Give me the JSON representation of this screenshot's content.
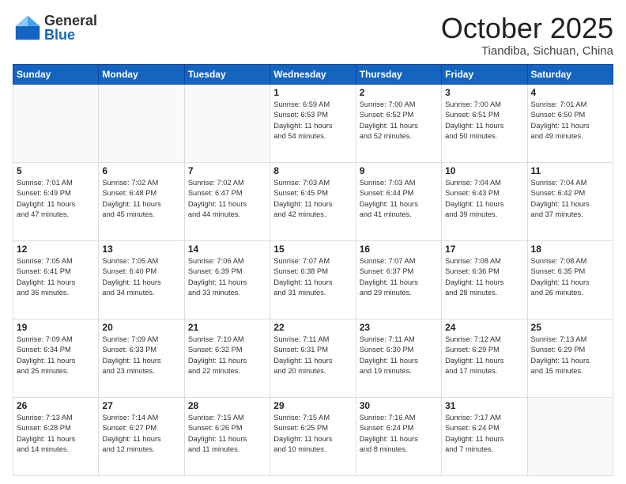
{
  "header": {
    "logo_general": "General",
    "logo_blue": "Blue",
    "month": "October 2025",
    "location": "Tiandiba, Sichuan, China"
  },
  "weekdays": [
    "Sunday",
    "Monday",
    "Tuesday",
    "Wednesday",
    "Thursday",
    "Friday",
    "Saturday"
  ],
  "weeks": [
    [
      {
        "day": "",
        "info": ""
      },
      {
        "day": "",
        "info": ""
      },
      {
        "day": "",
        "info": ""
      },
      {
        "day": "1",
        "info": "Sunrise: 6:59 AM\nSunset: 6:53 PM\nDaylight: 11 hours\nand 54 minutes."
      },
      {
        "day": "2",
        "info": "Sunrise: 7:00 AM\nSunset: 6:52 PM\nDaylight: 11 hours\nand 52 minutes."
      },
      {
        "day": "3",
        "info": "Sunrise: 7:00 AM\nSunset: 6:51 PM\nDaylight: 11 hours\nand 50 minutes."
      },
      {
        "day": "4",
        "info": "Sunrise: 7:01 AM\nSunset: 6:50 PM\nDaylight: 11 hours\nand 49 minutes."
      }
    ],
    [
      {
        "day": "5",
        "info": "Sunrise: 7:01 AM\nSunset: 6:49 PM\nDaylight: 11 hours\nand 47 minutes."
      },
      {
        "day": "6",
        "info": "Sunrise: 7:02 AM\nSunset: 6:48 PM\nDaylight: 11 hours\nand 45 minutes."
      },
      {
        "day": "7",
        "info": "Sunrise: 7:02 AM\nSunset: 6:47 PM\nDaylight: 11 hours\nand 44 minutes."
      },
      {
        "day": "8",
        "info": "Sunrise: 7:03 AM\nSunset: 6:45 PM\nDaylight: 11 hours\nand 42 minutes."
      },
      {
        "day": "9",
        "info": "Sunrise: 7:03 AM\nSunset: 6:44 PM\nDaylight: 11 hours\nand 41 minutes."
      },
      {
        "day": "10",
        "info": "Sunrise: 7:04 AM\nSunset: 6:43 PM\nDaylight: 11 hours\nand 39 minutes."
      },
      {
        "day": "11",
        "info": "Sunrise: 7:04 AM\nSunset: 6:42 PM\nDaylight: 11 hours\nand 37 minutes."
      }
    ],
    [
      {
        "day": "12",
        "info": "Sunrise: 7:05 AM\nSunset: 6:41 PM\nDaylight: 11 hours\nand 36 minutes."
      },
      {
        "day": "13",
        "info": "Sunrise: 7:05 AM\nSunset: 6:40 PM\nDaylight: 11 hours\nand 34 minutes."
      },
      {
        "day": "14",
        "info": "Sunrise: 7:06 AM\nSunset: 6:39 PM\nDaylight: 11 hours\nand 33 minutes."
      },
      {
        "day": "15",
        "info": "Sunrise: 7:07 AM\nSunset: 6:38 PM\nDaylight: 11 hours\nand 31 minutes."
      },
      {
        "day": "16",
        "info": "Sunrise: 7:07 AM\nSunset: 6:37 PM\nDaylight: 11 hours\nand 29 minutes."
      },
      {
        "day": "17",
        "info": "Sunrise: 7:08 AM\nSunset: 6:36 PM\nDaylight: 11 hours\nand 28 minutes."
      },
      {
        "day": "18",
        "info": "Sunrise: 7:08 AM\nSunset: 6:35 PM\nDaylight: 11 hours\nand 26 minutes."
      }
    ],
    [
      {
        "day": "19",
        "info": "Sunrise: 7:09 AM\nSunset: 6:34 PM\nDaylight: 11 hours\nand 25 minutes."
      },
      {
        "day": "20",
        "info": "Sunrise: 7:09 AM\nSunset: 6:33 PM\nDaylight: 11 hours\nand 23 minutes."
      },
      {
        "day": "21",
        "info": "Sunrise: 7:10 AM\nSunset: 6:32 PM\nDaylight: 11 hours\nand 22 minutes."
      },
      {
        "day": "22",
        "info": "Sunrise: 7:11 AM\nSunset: 6:31 PM\nDaylight: 11 hours\nand 20 minutes."
      },
      {
        "day": "23",
        "info": "Sunrise: 7:11 AM\nSunset: 6:30 PM\nDaylight: 11 hours\nand 19 minutes."
      },
      {
        "day": "24",
        "info": "Sunrise: 7:12 AM\nSunset: 6:29 PM\nDaylight: 11 hours\nand 17 minutes."
      },
      {
        "day": "25",
        "info": "Sunrise: 7:13 AM\nSunset: 6:29 PM\nDaylight: 11 hours\nand 15 minutes."
      }
    ],
    [
      {
        "day": "26",
        "info": "Sunrise: 7:13 AM\nSunset: 6:28 PM\nDaylight: 11 hours\nand 14 minutes."
      },
      {
        "day": "27",
        "info": "Sunrise: 7:14 AM\nSunset: 6:27 PM\nDaylight: 11 hours\nand 12 minutes."
      },
      {
        "day": "28",
        "info": "Sunrise: 7:15 AM\nSunset: 6:26 PM\nDaylight: 11 hours\nand 11 minutes."
      },
      {
        "day": "29",
        "info": "Sunrise: 7:15 AM\nSunset: 6:25 PM\nDaylight: 11 hours\nand 10 minutes."
      },
      {
        "day": "30",
        "info": "Sunrise: 7:16 AM\nSunset: 6:24 PM\nDaylight: 11 hours\nand 8 minutes."
      },
      {
        "day": "31",
        "info": "Sunrise: 7:17 AM\nSunset: 6:24 PM\nDaylight: 11 hours\nand 7 minutes."
      },
      {
        "day": "",
        "info": ""
      }
    ]
  ]
}
